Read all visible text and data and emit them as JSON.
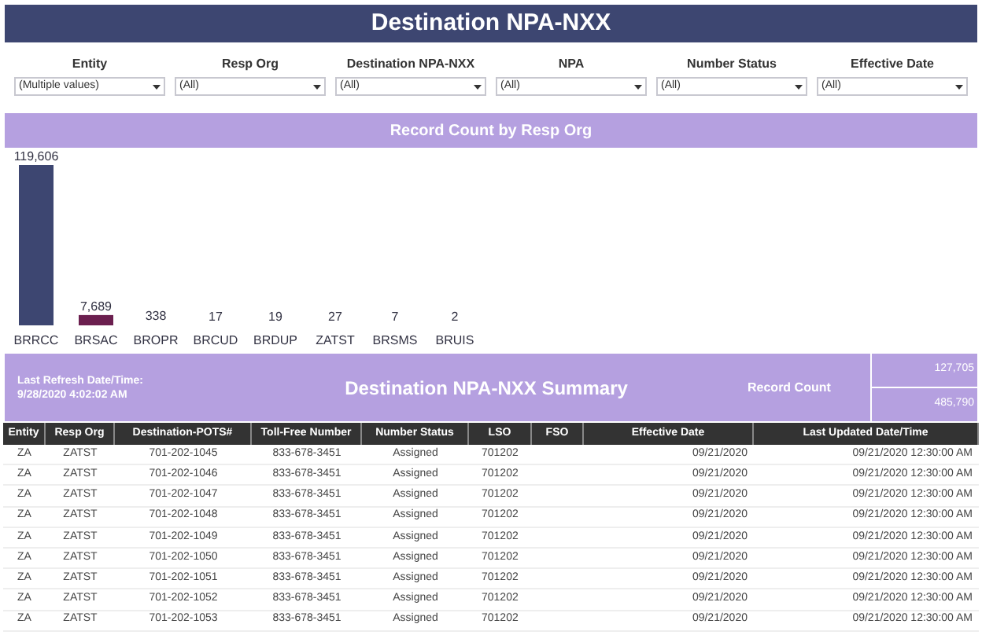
{
  "title": "Destination NPA-NXX",
  "filters": [
    {
      "label": "Entity",
      "value": "(Multiple values)"
    },
    {
      "label": "Resp Org",
      "value": "(All)"
    },
    {
      "label": "Destination NPA-NXX",
      "value": "(All)"
    },
    {
      "label": "NPA",
      "value": "(All)"
    },
    {
      "label": "Number Status",
      "value": "(All)"
    },
    {
      "label": "Effective Date",
      "value": "(All)"
    }
  ],
  "chart": {
    "title": "Record Count by Resp Org",
    "chart_data": {
      "type": "bar",
      "categories": [
        "BRRCC",
        "BRSAC",
        "BROPR",
        "BRCUD",
        "BRDUP",
        "ZATST",
        "BRSMS",
        "BRUIS"
      ],
      "series": [
        {
          "color": "#3d4671",
          "values": [
            119606,
            null,
            338,
            17,
            19,
            27,
            7,
            2
          ],
          "value_labels": [
            "119,606",
            null,
            "338",
            "17",
            "19",
            "27",
            "7",
            "2"
          ]
        },
        {
          "color": "#6b1f4f",
          "values": [
            null,
            7689,
            null,
            null,
            null,
            null,
            null,
            null
          ],
          "value_labels": [
            null,
            "7,689",
            null,
            null,
            null,
            null,
            null,
            null
          ]
        }
      ],
      "data_labels": true
    }
  },
  "summary": {
    "refresh_label": "Last Refresh Date/Time:",
    "refresh_value": "9/28/2020 4:02:02 AM",
    "title": "Destination NPA-NXX Summary",
    "record_count_label": "Record Count",
    "record_counts": [
      "127,705",
      "485,790"
    ]
  },
  "table": {
    "columns": [
      "Entity",
      "Resp Org",
      "Destination-POTS#",
      "Toll-Free Number",
      "Number Status",
      "LSO",
      "FSO",
      "Effective Date",
      "Last Updated Date/Time"
    ],
    "rows": [
      [
        "ZA",
        "ZATST",
        "701-202-1045",
        "833-678-3451",
        "Assigned",
        "701202",
        "",
        "09/21/2020",
        "09/21/2020 12:30:00 AM"
      ],
      [
        "ZA",
        "ZATST",
        "701-202-1046",
        "833-678-3451",
        "Assigned",
        "701202",
        "",
        "09/21/2020",
        "09/21/2020 12:30:00 AM"
      ],
      [
        "ZA",
        "ZATST",
        "701-202-1047",
        "833-678-3451",
        "Assigned",
        "701202",
        "",
        "09/21/2020",
        "09/21/2020 12:30:00 AM"
      ],
      [
        "ZA",
        "ZATST",
        "701-202-1048",
        "833-678-3451",
        "Assigned",
        "701202",
        "",
        "09/21/2020",
        "09/21/2020 12:30:00 AM"
      ],
      [
        "ZA",
        "ZATST",
        "701-202-1049",
        "833-678-3451",
        "Assigned",
        "701202",
        "",
        "09/21/2020",
        "09/21/2020 12:30:00 AM"
      ],
      [
        "ZA",
        "ZATST",
        "701-202-1050",
        "833-678-3451",
        "Assigned",
        "701202",
        "",
        "09/21/2020",
        "09/21/2020 12:30:00 AM"
      ],
      [
        "ZA",
        "ZATST",
        "701-202-1051",
        "833-678-3451",
        "Assigned",
        "701202",
        "",
        "09/21/2020",
        "09/21/2020 12:30:00 AM"
      ],
      [
        "ZA",
        "ZATST",
        "701-202-1052",
        "833-678-3451",
        "Assigned",
        "701202",
        "",
        "09/21/2020",
        "09/21/2020 12:30:00 AM"
      ],
      [
        "ZA",
        "ZATST",
        "701-202-1053",
        "833-678-3451",
        "Assigned",
        "701202",
        "",
        "09/21/2020",
        "09/21/2020 12:30:00 AM"
      ]
    ]
  }
}
